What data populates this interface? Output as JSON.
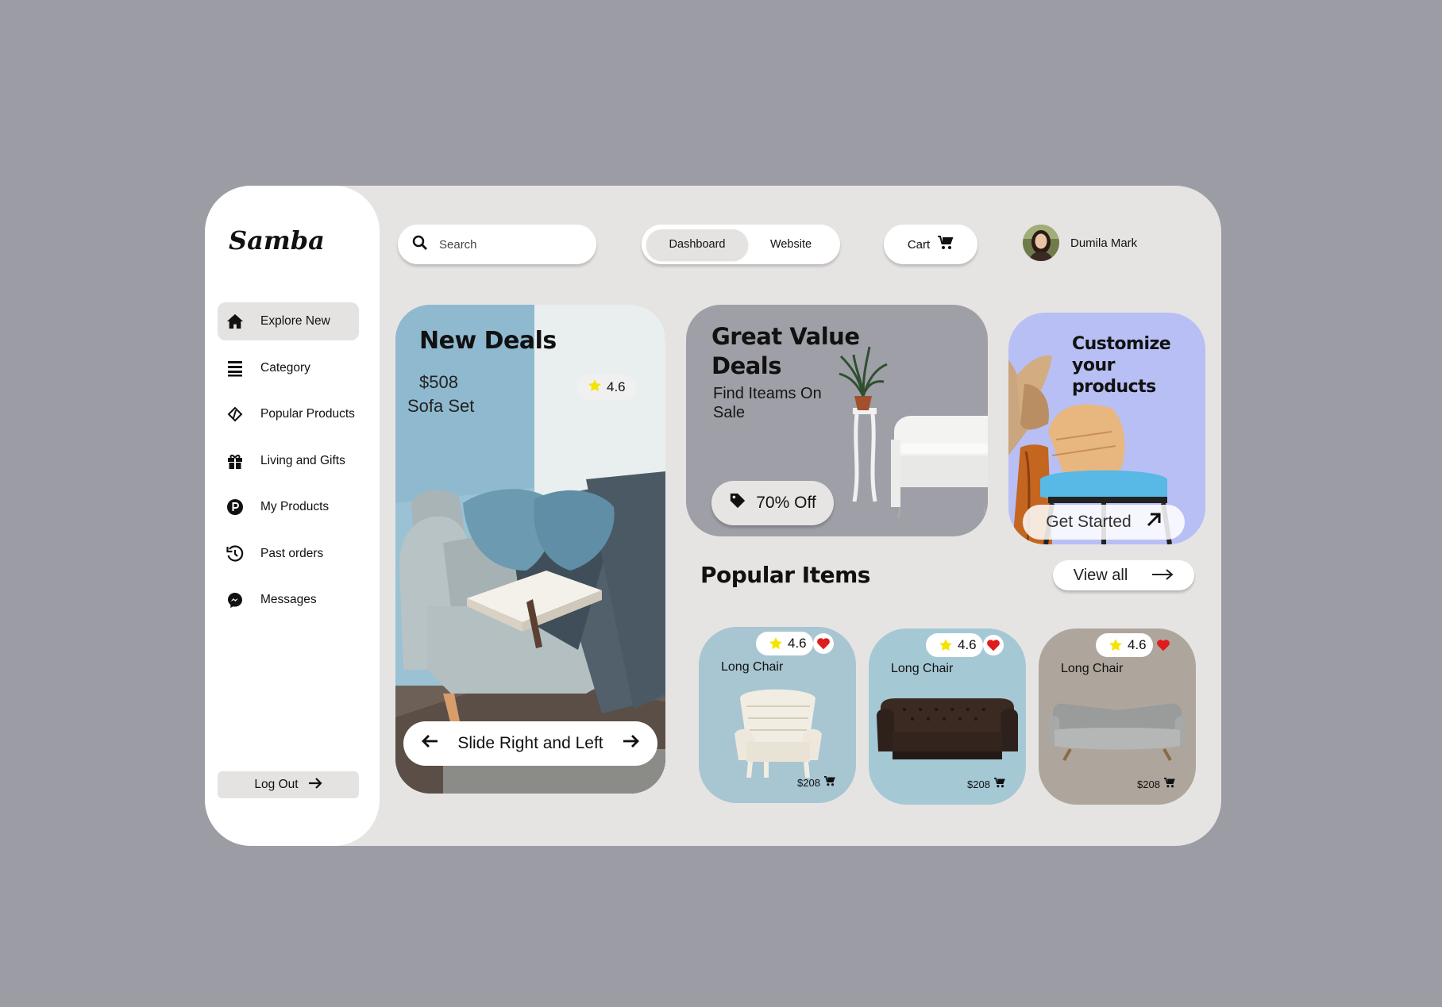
{
  "brand": {
    "logo": "Samba"
  },
  "nav": {
    "items": [
      {
        "label": "Explore New",
        "icon": "home-icon",
        "active": true
      },
      {
        "label": "Category",
        "icon": "list-icon"
      },
      {
        "label": "Popular Products",
        "icon": "diamond-code-icon"
      },
      {
        "label": "Living and Gifts",
        "icon": "gift-icon"
      },
      {
        "label": "My Products",
        "icon": "p-circle-icon"
      },
      {
        "label": "Past orders",
        "icon": "history-icon"
      },
      {
        "label": "Messages",
        "icon": "messenger-icon"
      }
    ],
    "logout_label": "Log Out"
  },
  "header": {
    "search_placeholder": "Search",
    "toggle": {
      "active": "Dashboard",
      "inactive": "Website"
    },
    "cart_label": "Cart",
    "user_name": "Dumila Mark"
  },
  "hero": {
    "title": "New Deals",
    "price": "$508",
    "product": "Sofa Set",
    "rating": "4.6",
    "slider_label": "Slide Right and Left"
  },
  "deal": {
    "title_line1": "Great Value",
    "title_line2": "Deals",
    "subtitle_line1": "Find Iteams On",
    "subtitle_line2": "Sale",
    "discount": "70% Off"
  },
  "customize": {
    "line1": "Customize",
    "line2": "your",
    "line3": "products",
    "button": "Get Started"
  },
  "popular": {
    "title": "Popular Items",
    "view_all": "View all",
    "cards": [
      {
        "name": "Long Chair",
        "rating": "4.6",
        "price": "$208",
        "bg": "#a8c5d2"
      },
      {
        "name": "Long Chair",
        "rating": "4.6",
        "price": "$208",
        "bg": "#a5c8d5"
      },
      {
        "name": "Long Chair",
        "rating": "4.6",
        "price": "$208",
        "bg": "#aea69c"
      }
    ]
  },
  "colors": {
    "page_bg": "#9c9ca5",
    "frame_bg": "#e6e4e2",
    "star": "#f5e400",
    "heart": "#e01b1b",
    "customize_bg": "#b8bff5"
  }
}
